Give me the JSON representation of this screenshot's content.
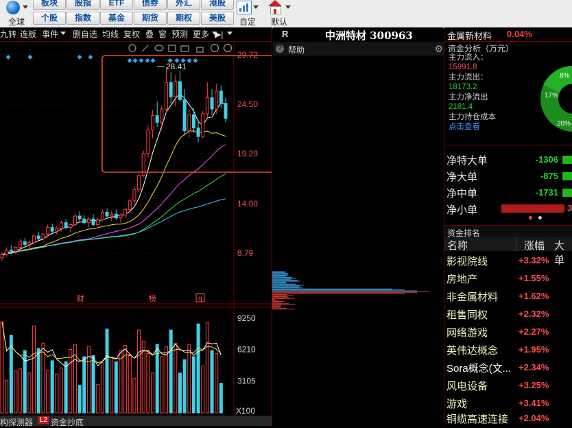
{
  "toolbar": {
    "global_label": "全球",
    "row1": [
      "板块",
      "股指",
      "ETF",
      "债券",
      "外汇",
      "港股"
    ],
    "row2": [
      "个股",
      "指数",
      "基金",
      "期货",
      "期权",
      "美股"
    ],
    "custom_label": "自定",
    "default_label": "默认"
  },
  "chart_toolbar": {
    "items": [
      "九转",
      "连板",
      "事件",
      "删自选",
      "均线",
      "复权",
      "叠",
      "窗",
      "预测",
      "更多"
    ]
  },
  "stock": {
    "mark": "R",
    "name": "中洲特材 300963"
  },
  "help": {
    "label": "帮助"
  },
  "chart_data": {
    "type": "candlestick",
    "price_axis_labels": [
      "29.72",
      "24.50",
      "19.29",
      "14.00",
      "8.79"
    ],
    "price_annotation": "28.41",
    "event_markers": [
      "财",
      "榜",
      "q"
    ],
    "volume_axis_labels": [
      "9250",
      "6210",
      "3105"
    ],
    "volume_unit": "X100",
    "candles": [
      [
        8.3,
        8.9,
        8.0,
        8.6
      ],
      [
        8.6,
        9.4,
        8.4,
        9.1
      ],
      [
        9.1,
        9.6,
        8.8,
        9.0
      ],
      [
        9.0,
        9.5,
        8.7,
        9.4
      ],
      [
        9.4,
        10.3,
        9.2,
        10.0
      ],
      [
        10.0,
        10.4,
        9.5,
        9.7
      ],
      [
        9.7,
        10.1,
        9.3,
        9.9
      ],
      [
        9.9,
        10.8,
        9.7,
        10.6
      ],
      [
        10.6,
        11.0,
        10.1,
        10.3
      ],
      [
        10.3,
        10.9,
        10.0,
        10.8
      ],
      [
        10.8,
        11.8,
        10.5,
        11.5
      ],
      [
        11.5,
        11.9,
        10.9,
        11.1
      ],
      [
        11.1,
        11.6,
        10.7,
        11.4
      ],
      [
        11.4,
        12.2,
        11.1,
        12.0
      ],
      [
        12.0,
        12.4,
        11.3,
        11.5
      ],
      [
        11.5,
        11.9,
        11.0,
        11.8
      ],
      [
        11.8,
        13.0,
        11.6,
        12.7
      ],
      [
        12.7,
        13.2,
        12.1,
        12.4
      ],
      [
        12.4,
        12.8,
        11.8,
        12.0
      ],
      [
        12.0,
        12.6,
        11.5,
        12.4
      ],
      [
        12.4,
        12.9,
        11.6,
        11.8
      ],
      [
        11.8,
        12.5,
        11.4,
        12.3
      ],
      [
        12.3,
        13.4,
        12.1,
        13.1
      ],
      [
        13.1,
        13.5,
        12.4,
        12.7
      ],
      [
        12.7,
        13.2,
        12.2,
        12.9
      ],
      [
        12.9,
        13.4,
        12.3,
        12.5
      ],
      [
        12.5,
        13.0,
        12.0,
        12.8
      ],
      [
        12.8,
        13.6,
        12.5,
        13.4
      ],
      [
        13.4,
        14.5,
        13.2,
        14.3
      ],
      [
        14.3,
        15.8,
        14.0,
        15.5
      ],
      [
        15.5,
        17.3,
        15.2,
        17.0
      ],
      [
        17.0,
        19.6,
        16.8,
        19.3
      ],
      [
        19.3,
        22.3,
        18.9,
        21.8
      ],
      [
        21.8,
        23.9,
        20.9,
        23.3
      ],
      [
        23.3,
        24.8,
        22.1,
        22.6
      ],
      [
        22.6,
        24.4,
        21.8,
        24.0
      ],
      [
        24.0,
        28.4,
        23.6,
        26.8
      ],
      [
        26.8,
        27.9,
        24.6,
        25.3
      ],
      [
        25.3,
        27.6,
        24.3,
        26.9
      ],
      [
        26.9,
        28.0,
        24.8,
        25.0
      ],
      [
        25.0,
        26.1,
        21.2,
        21.7
      ],
      [
        21.7,
        23.9,
        21.0,
        23.4
      ],
      [
        23.4,
        24.1,
        21.5,
        22.0
      ],
      [
        22.0,
        22.8,
        20.5,
        21.1
      ],
      [
        21.1,
        23.8,
        20.9,
        23.5
      ],
      [
        23.5,
        26.8,
        23.1,
        25.2
      ],
      [
        25.2,
        26.1,
        23.4,
        24.0
      ],
      [
        24.0,
        26.7,
        23.5,
        25.9
      ],
      [
        25.9,
        26.5,
        24.1,
        24.6
      ],
      [
        24.6,
        25.2,
        22.6,
        23.0
      ]
    ],
    "volumes": [
      8900,
      3200,
      7600,
      4100,
      4300,
      6100,
      3900,
      8500,
      6300,
      6800,
      4200,
      5100,
      3800,
      4400,
      5000,
      6200,
      6700,
      2700,
      5500,
      6500,
      5600,
      2800,
      4900,
      8200,
      5400,
      5000,
      6100,
      6600,
      5600,
      3400,
      8100,
      7000,
      5800,
      3900,
      6700,
      5500,
      6500,
      8100,
      6800,
      3900,
      5200,
      6700,
      5500,
      8700,
      4600,
      8800,
      6100,
      5800,
      2900
    ]
  },
  "side": {
    "sector": "金属新材料",
    "sector_change": "0.04%",
    "fund_title": "资金分析（万元）",
    "fund": [
      {
        "label": "主力流入：",
        "value": "15991.8"
      },
      {
        "label": "主力流出：",
        "value": "18173.2"
      },
      {
        "label": "主力净流出",
        "value": "2181.4"
      },
      {
        "label": "主力持仓成本",
        "value": "点击查看"
      }
    ],
    "pie": {
      "labels": [
        "8%",
        "17%",
        "20%"
      ]
    },
    "net": [
      {
        "label": "净特大单",
        "value": "-1306"
      },
      {
        "label": "净大单",
        "value": "-875"
      },
      {
        "label": "净中单",
        "value": "-1731"
      },
      {
        "label": "净小单",
        "value": "3"
      }
    ],
    "rank_title": "资金排名",
    "cols": [
      "名称",
      "涨幅",
      "大单"
    ],
    "rank": [
      {
        "name": "影视院线",
        "change": "+3.32%"
      },
      {
        "name": "房地产",
        "change": "+1.55%"
      },
      {
        "name": "非金属材料",
        "change": "+1.62%"
      },
      {
        "name": "租售同权",
        "change": "+2.32%"
      },
      {
        "name": "网络游戏",
        "change": "+2.27%"
      },
      {
        "name": "英伟达概念",
        "change": "+1.95%"
      },
      {
        "name": "Sora概念(文...",
        "change": "+2.34%"
      },
      {
        "name": "风电设备",
        "change": "+3.25%"
      },
      {
        "name": "游戏",
        "change": "+3.41%"
      },
      {
        "name": "铜缆高速连接",
        "change": "+2.04%"
      }
    ]
  },
  "bottom": {
    "tabs": [
      "构探测器",
      "资金抄底"
    ],
    "tab_badge": "L2"
  }
}
